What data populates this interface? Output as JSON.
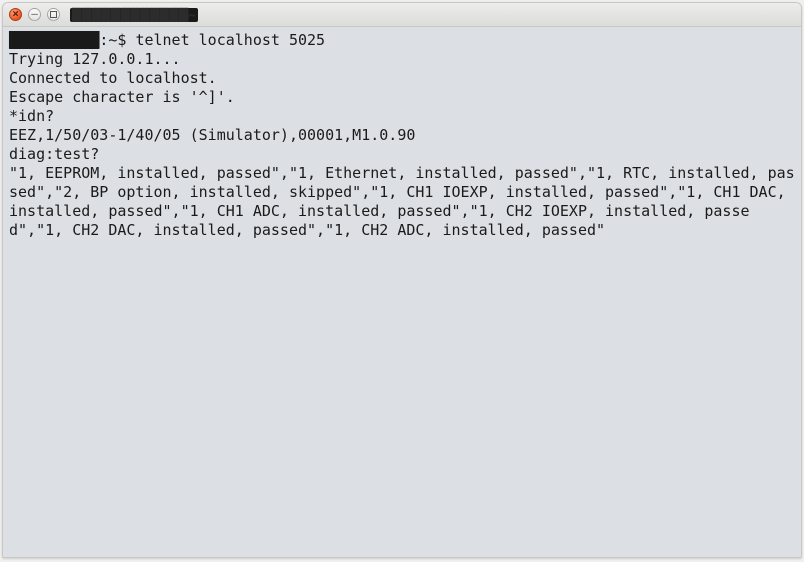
{
  "window": {
    "title": "████████████~"
  },
  "terminal": {
    "prompt_host": "██████████",
    "prompt_suffix": ":~$ ",
    "command": "telnet localhost 5025",
    "lines": {
      "l1": "Trying 127.0.0.1...",
      "l2": "Connected to localhost.",
      "l3": "Escape character is '^]'.",
      "l4": "*idn?",
      "l5": "EEZ,1/50/03-1/40/05 (Simulator),00001,M1.0.90",
      "l6": "diag:test?",
      "l7": "\"1, EEPROM, installed, passed\",\"1, Ethernet, installed, passed\",\"1, RTC, installed, passed\",\"2, BP option, installed, skipped\",\"1, CH1 IOEXP, installed, passed\",\"1, CH1 DAC, installed, passed\",\"1, CH1 ADC, installed, passed\",\"1, CH2 IOEXP, installed, passed\",\"1, CH2 DAC, installed, passed\",\"1, CH2 ADC, installed, passed\""
    }
  }
}
